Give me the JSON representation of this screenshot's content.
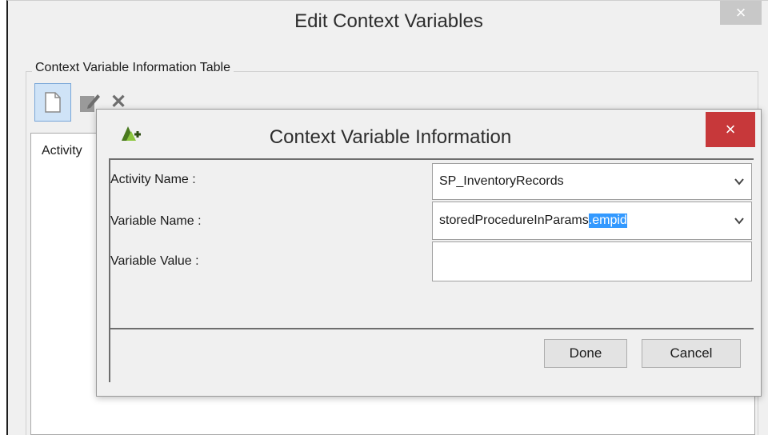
{
  "outer_window": {
    "title": "Edit Context Variables",
    "close_glyph": "×"
  },
  "group": {
    "label": "Context Variable Information Table"
  },
  "toolbar": {
    "new_icon": "new-document-icon",
    "edit_icon": "edit-icon",
    "delete_icon": "delete-icon",
    "delete_glyph": "✕"
  },
  "table": {
    "header_first_col": "Activity"
  },
  "dialog": {
    "title": "Context Variable Information",
    "close_glyph": "×",
    "logo_icon": "app-logo-icon"
  },
  "form": {
    "activity_label": "Activity Name :",
    "activity_value": "SP_InventoryRecords",
    "variable_label": "Variable Name :",
    "variable_value_plain": "storedProcedureInParams",
    "variable_value_selected": ".empid",
    "value_label": "Variable Value :",
    "value_value": ""
  },
  "buttons": {
    "done": "Done",
    "cancel": "Cancel"
  },
  "colors": {
    "close_red": "#c7383a",
    "selection_blue": "#3399ff",
    "toolbar_active": "#cfe3f7"
  }
}
